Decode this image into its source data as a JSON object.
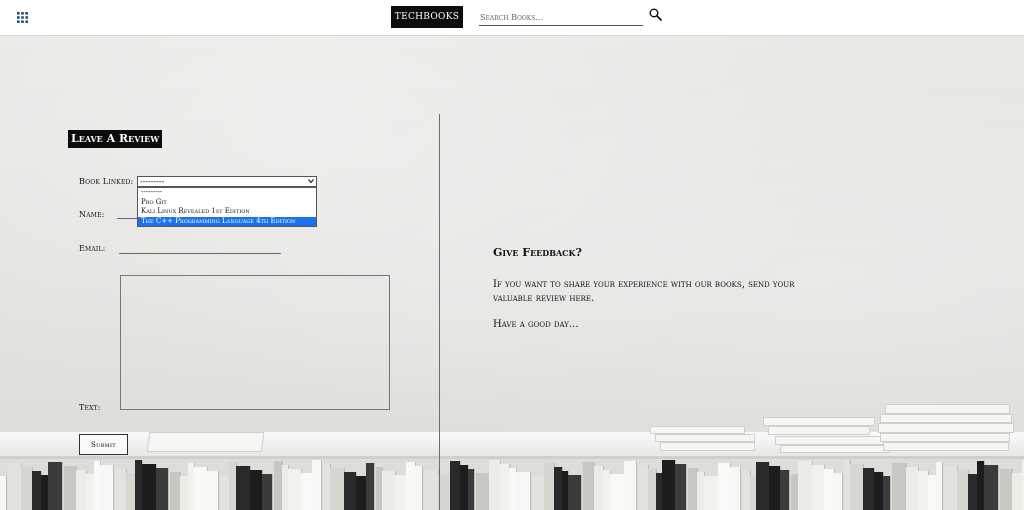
{
  "header": {
    "brand": "TECHBOOKS",
    "search_placeholder": "Search Books...",
    "icons": {
      "menu": "apps-grid-icon",
      "search": "magnifier-icon"
    }
  },
  "review_form": {
    "title": "Leave A Review",
    "book_label": "Book Linked:",
    "book_selected": "---------",
    "book_options": [
      "---------",
      "Pro Git",
      "Kali Linux Revealed 1st Edition",
      "The C++ Programming Language 4th Edition"
    ],
    "highlighted_option": "The C++ Programming Language 4th Edition",
    "name_label": "Name:",
    "name_value": "",
    "email_label": "Email:",
    "email_value": "",
    "text_label": "Text:",
    "text_value": "",
    "submit_label": "Submit"
  },
  "feedback": {
    "title": "Give Feedback?",
    "body": "If you want to share your experience with our books, send your valuable review here.",
    "sign_off": "Have a good day..."
  },
  "colors": {
    "brand_bg": "#0c0c0c",
    "highlight": "#1a73e8",
    "wall": "#e6e5e2"
  }
}
